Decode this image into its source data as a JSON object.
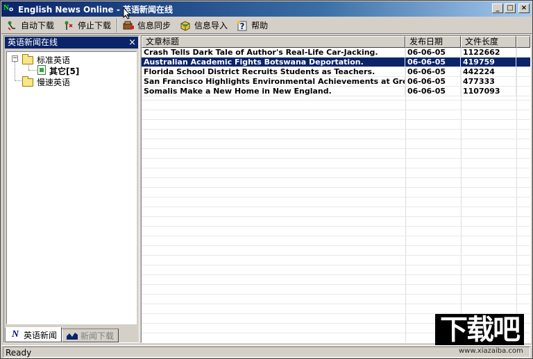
{
  "window": {
    "title": "English News Online - 英语新闻在线",
    "app_icon": "news-online-app-icon"
  },
  "toolbar": {
    "items": [
      {
        "label": "自动下载",
        "icon": "auto-download-icon"
      },
      {
        "label": "停止下载",
        "icon": "stop-download-icon"
      },
      {
        "label": "信息同步",
        "icon": "sync-icon"
      },
      {
        "label": "信息导入",
        "icon": "import-icon"
      },
      {
        "label": "帮助",
        "icon": "help-icon"
      }
    ]
  },
  "sidebar": {
    "header": "英语新闻在线",
    "close": "×",
    "tree": {
      "standard": {
        "label": "标准英语",
        "expander": "−"
      },
      "other": {
        "label": "其它[5]"
      },
      "slow": {
        "label": "慢速英语"
      }
    },
    "tabs": [
      {
        "label": "英语新闻",
        "icon": "N"
      },
      {
        "label": "新闻下载"
      }
    ]
  },
  "list": {
    "columns": [
      "文章标题",
      "发布日期",
      "文件长度"
    ],
    "rows": [
      {
        "title": "Crash Tells Dark Tale of Author's Real-Life Car-Jacking.",
        "date": "06-06-05",
        "size": "1122662"
      },
      {
        "title": "Australian Academic Fights Botswana Deportation.",
        "date": "06-06-05",
        "size": "419759"
      },
      {
        "title": "Florida School District Recruits Students as Teachers.",
        "date": "06-06-05",
        "size": "442224"
      },
      {
        "title": "San Francisco Highlights Environmental Achievements at Green ...",
        "date": "06-06-05",
        "size": "477333"
      },
      {
        "title": "Somalis Make a New Home in New England.",
        "date": "06-06-05",
        "size": "1107093"
      }
    ],
    "selected_index": 1
  },
  "status": {
    "text": "Ready"
  },
  "watermark": {
    "logo": "下载吧",
    "url": "www.xiazaiba.com"
  },
  "colors": {
    "titlebar": "#0a246a",
    "selection": "#0a246a",
    "face": "#d4d0c8"
  }
}
